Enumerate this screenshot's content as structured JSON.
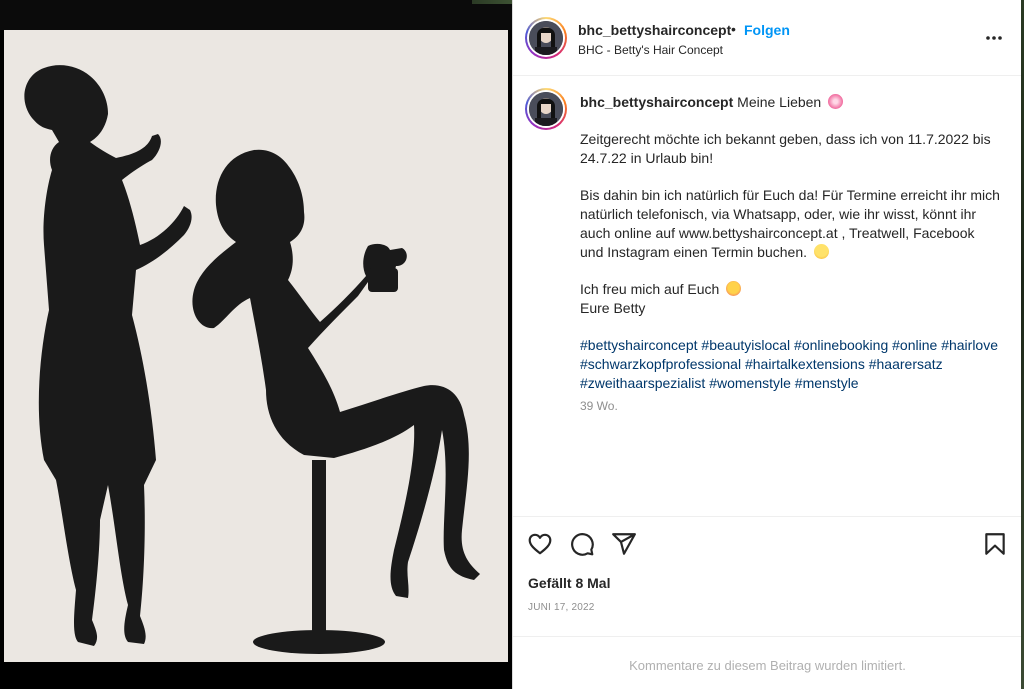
{
  "post": {
    "username": "bhc_bettyshairconcept",
    "separator": "•",
    "follow_label": "Folgen",
    "subtitle": "BHC - Betty's Hair Concept",
    "more_icon": "more-horizontal-icon"
  },
  "caption": {
    "username": "bhc_bettyshairconcept",
    "first_line": "Meine Lieben",
    "first_line_emoji": "cherry-blossom-emoji",
    "paragraph1": "Zeitgerecht möchte ich bekannt geben, dass ich von 11.7.2022 bis 24.7.22 in Urlaub bin!",
    "paragraph2": "Bis dahin bin ich natürlich für Euch da! Für Termine erreicht ihr mich natürlich telefonisch, via Whatsapp, oder, wie ihr wisst, könnt ihr auch online auf www.bettyshairconcept.at , Treatwell, Facebook und Instagram einen Termin buchen.",
    "paragraph2_emoji": "grinning-face-emoji",
    "paragraph3_line1": "Ich freu mich auf Euch",
    "paragraph3_emoji": "smiling-face-with-hearts-emoji",
    "paragraph3_line2": "Eure Betty",
    "hashtags": [
      "#bettyshairconcept",
      "#beautyislocal",
      "#onlinebooking",
      "#online",
      "#hairlove",
      "#schwarzkopfprofessional",
      "#hairtalkextensions",
      "#haarersatz",
      "#zweithaarspezialist",
      "#womenstyle",
      "#menstyle"
    ],
    "time": "39 Wo."
  },
  "actions": {
    "like_icon": "heart-icon",
    "comment_icon": "comment-icon",
    "share_icon": "paper-plane-icon",
    "save_icon": "bookmark-icon",
    "likes": "Gefällt 8 Mal",
    "date": "JUNI 17, 2022"
  },
  "footer": {
    "comments_limited": "Kommentare zu diesem Beitrag wurden limitiert."
  },
  "colors": {
    "link": "#00376b",
    "follow": "#0095f6",
    "text": "#262626",
    "muted": "#8e8e8e"
  }
}
